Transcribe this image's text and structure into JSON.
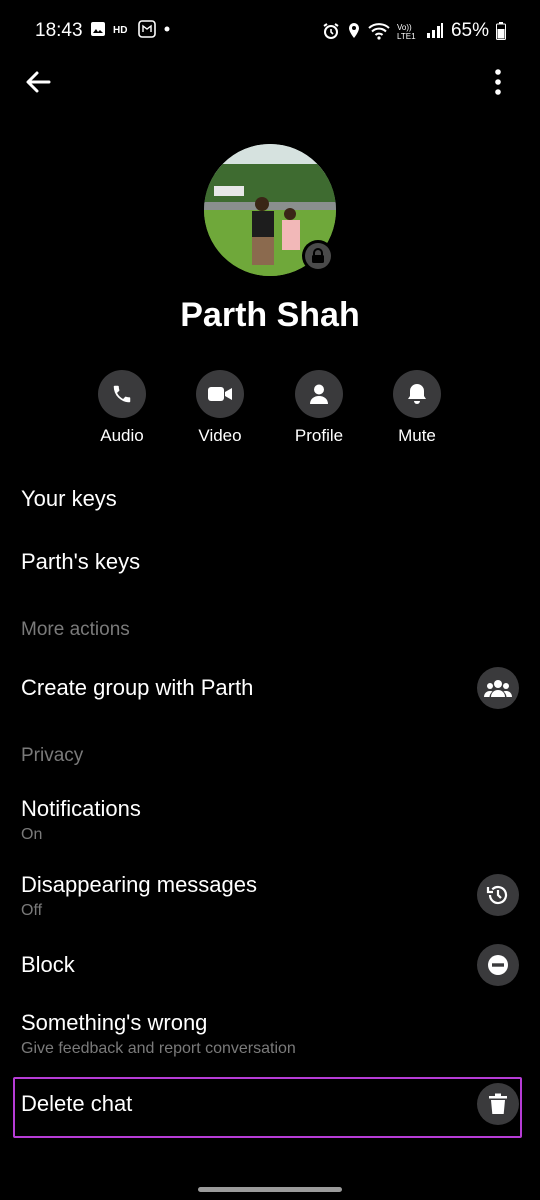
{
  "status_bar": {
    "time": "18:43",
    "battery": "65%",
    "left_icons": [
      "image-icon",
      "hd-icon",
      "voice-icon",
      "dot-icon"
    ],
    "right_icons": [
      "alarm-icon",
      "location-icon",
      "wifi-icon",
      "volte-icon",
      "signal-icon",
      "battery-icon"
    ]
  },
  "header": {
    "back_icon": "back-arrow-icon",
    "more_icon": "more-vertical-icon"
  },
  "profile": {
    "name": "Parth Shah",
    "lock_icon": "lock-icon"
  },
  "actions": [
    {
      "label": "Audio",
      "icon": "phone-icon"
    },
    {
      "label": "Video",
      "icon": "video-camera-icon"
    },
    {
      "label": "Profile",
      "icon": "person-icon"
    },
    {
      "label": "Mute",
      "icon": "bell-icon"
    }
  ],
  "menu": {
    "your_keys": "Your keys",
    "parth_keys": "Parth's keys",
    "section_more": "More actions",
    "create_group": "Create group with Parth",
    "section_privacy": "Privacy",
    "notifications": "Notifications",
    "notifications_sub": "On",
    "disappearing": "Disappearing messages",
    "disappearing_sub": "Off",
    "block": "Block",
    "something_wrong": "Something's wrong",
    "something_wrong_sub": "Give feedback and report conversation",
    "delete_chat": "Delete chat"
  },
  "colors": {
    "background": "#000000",
    "icon_bg": "#3a3a3c",
    "secondary_text": "#7a7a7a",
    "highlight": "#b63cd6"
  }
}
